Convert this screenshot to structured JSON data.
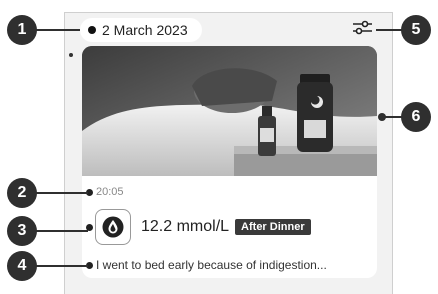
{
  "entry": {
    "date": "2 March 2023",
    "time": "20:05",
    "reading": "12.2 mmol/L",
    "meal_tag": "After Dinner",
    "note": "I went to bed early because of indigestion..."
  },
  "icons": {
    "filter": "sliders-icon",
    "measurement": "blood-drop-icon"
  },
  "callouts": [
    "1",
    "2",
    "3",
    "4",
    "5",
    "6"
  ],
  "colors": {
    "accent": "#2f2f2f",
    "background": "#f2f2f2",
    "card": "#ffffff"
  }
}
